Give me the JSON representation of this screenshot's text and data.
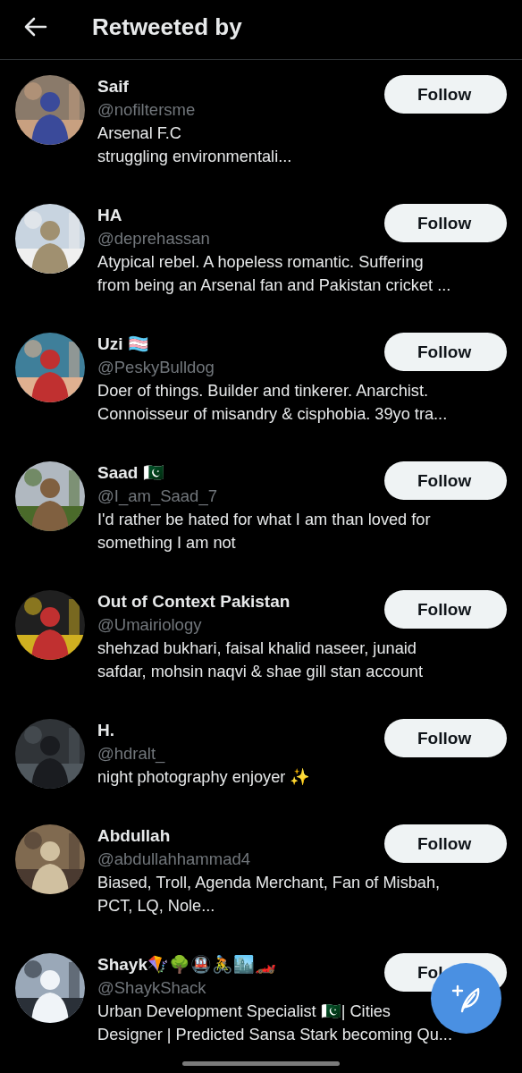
{
  "header": {
    "title": "Retweeted by"
  },
  "users": [
    {
      "name": "Saif",
      "handle": "@nofiltersme",
      "bio_lines": [
        "Arsenal F.C",
        "struggling environmentali..."
      ],
      "button": "Follow"
    },
    {
      "name": "HA",
      "handle": "@deprehassan",
      "bio_lines": [
        "Atypical rebel. A hopeless romantic. Suffering",
        "from being an Arsenal fan and Pakistan cricket ..."
      ],
      "button": "Follow"
    },
    {
      "name": "Uzi 🏳️‍⚧️",
      "handle": "@PeskyBulldog",
      "bio_lines": [
        "Doer of things. Builder and tinkerer. Anarchist.",
        "Connoisseur of misandry & cisphobia. 39yo tra..."
      ],
      "button": "Follow"
    },
    {
      "name": "Saad 🇵🇰",
      "handle": "@I_am_Saad_7",
      "bio_lines": [
        "I'd rather be hated for what I am than loved for",
        "something I am not"
      ],
      "button": "Follow"
    },
    {
      "name": "Out of Context Pakistan",
      "handle": "@Umairiology",
      "bio_lines": [
        "shehzad bukhari, faisal khalid naseer, junaid",
        "safdar, mohsin naqvi & shae gill stan account"
      ],
      "button": "Follow"
    },
    {
      "name": "H.",
      "handle": "@hdralt_",
      "bio_lines": [
        "night photography enjoyer ✨"
      ],
      "button": "Follow"
    },
    {
      "name": "Abdullah",
      "handle": "@abdullahhammad4",
      "bio_lines": [
        "Biased, Troll, Agenda Merchant, Fan of Misbah,",
        "PCT, LQ, Nole..."
      ],
      "button": "Follow"
    },
    {
      "name": "Shayk🪁🌳🚇🚴🏙️🏎️",
      "handle": "@ShaykShack",
      "bio_lines": [
        "Urban Development Specialist 🇵🇰| Cities",
        "Designer | Predicted Sansa Stark becoming Qu..."
      ],
      "button": "Fol"
    }
  ]
}
